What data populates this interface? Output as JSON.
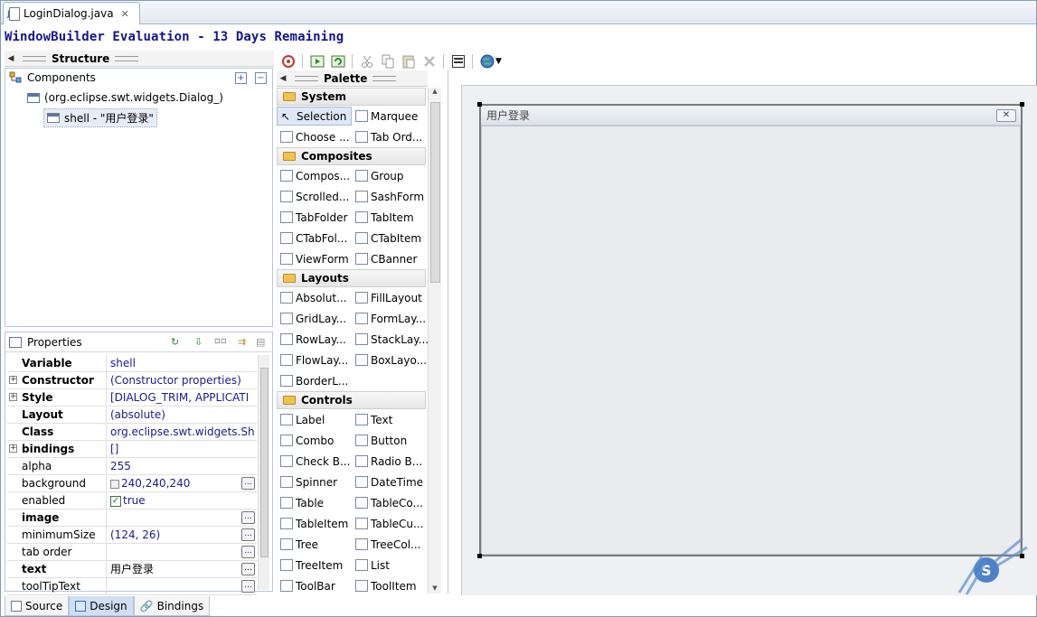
{
  "editor_tab": {
    "title": "LoginDialog.java",
    "close": "✕"
  },
  "banner": "WindowBuilder Evaluation - 13 Days Remaining",
  "structure": {
    "title": "Structure",
    "components_title": "Components",
    "tree": [
      {
        "label": "(org.eclipse.swt.widgets.Dialog_)"
      },
      {
        "label": "shell - \"用户登录\""
      }
    ]
  },
  "properties": {
    "title": "Properties",
    "rows": [
      {
        "name": "Variable",
        "value": "shell",
        "bold": true
      },
      {
        "name": "Constructor",
        "value": "(Constructor properties)",
        "bold": true,
        "expand": true
      },
      {
        "name": "Style",
        "value": "[DIALOG_TRIM, APPLICATI",
        "bold": true,
        "expand": true
      },
      {
        "name": "Layout",
        "value": "(absolute)",
        "bold": true
      },
      {
        "name": "Class",
        "value": "org.eclipse.swt.widgets.Sh",
        "bold": true
      },
      {
        "name": "bindings",
        "value": "[]",
        "bold": true,
        "expand": true
      },
      {
        "name": "alpha",
        "value": "255"
      },
      {
        "name": "background",
        "value": "240,240,240",
        "swatch": true,
        "button": true
      },
      {
        "name": "enabled",
        "value": "true",
        "check": true
      },
      {
        "name": "image",
        "value": "",
        "bold": true,
        "button": true
      },
      {
        "name": "minimumSize",
        "value": "(124, 26)",
        "button": true
      },
      {
        "name": "tab order",
        "value": "",
        "button": true
      },
      {
        "name": "text",
        "value": "用户登录",
        "bold": true,
        "button": true,
        "black": true
      },
      {
        "name": "toolTipText",
        "value": "",
        "button": true
      }
    ]
  },
  "bottom_tabs": [
    "Source",
    "Design",
    "Bindings"
  ],
  "palette": {
    "title": "Palette",
    "groups": [
      {
        "name": "System",
        "items": [
          "Selection",
          "Marquee",
          "Choose ...",
          "Tab Ord..."
        ]
      },
      {
        "name": "Composites",
        "items": [
          "Compos...",
          "Group",
          "Scrolled...",
          "SashForm",
          "TabFolder",
          "TabItem",
          "CTabFol...",
          "CTabItem",
          "ViewForm",
          "CBanner"
        ]
      },
      {
        "name": "Layouts",
        "items": [
          "Absolut...",
          "FillLayout",
          "GridLay...",
          "FormLay...",
          "RowLay...",
          "StackLay...",
          "FlowLay...",
          "BoxLayo...",
          "BorderL..."
        ]
      },
      {
        "name": "Controls",
        "items": [
          "Label",
          "Text",
          "Combo",
          "Button",
          "Check B...",
          "Radio B...",
          "Spinner",
          "DateTime",
          "Table",
          "TableCo...",
          "TableItem",
          "TableCu...",
          "Tree",
          "TreeCol...",
          "TreeItem",
          "List",
          "ToolBar",
          "ToolItem"
        ]
      }
    ]
  },
  "dialog": {
    "title": "用户登录",
    "close": "✕"
  },
  "colors": {
    "banner": "#151590",
    "value_text": "#1b1b8e",
    "selection_bg": "#dfe8f5",
    "folder": "#f2c251"
  }
}
